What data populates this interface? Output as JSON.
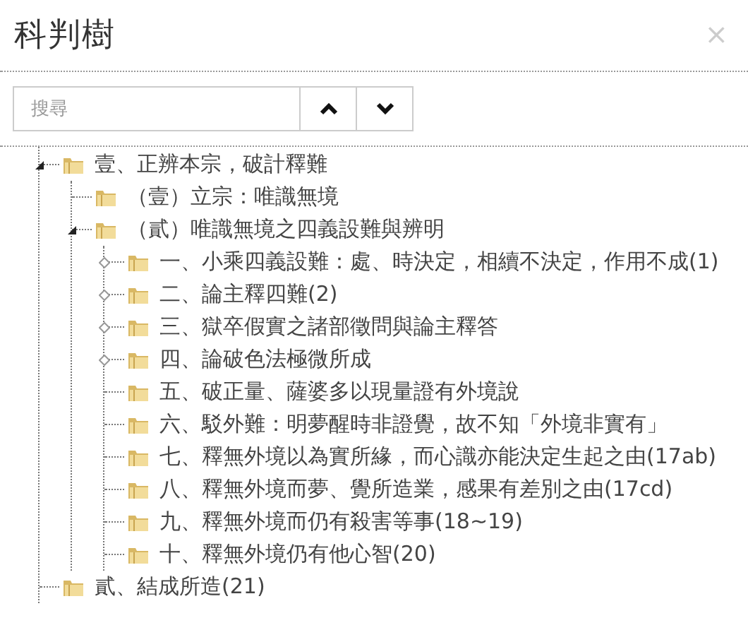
{
  "dialog": {
    "title": "科判樹",
    "close": "×"
  },
  "search": {
    "placeholder": "搜尋"
  },
  "tree": [
    {
      "label": "壹、正辨本宗，破計釋難",
      "expanded": true,
      "children": [
        {
          "label": "（壹）立宗：唯識無境"
        },
        {
          "label": "（貳）唯識無境之四義設難與辨明",
          "expanded": true,
          "children": [
            {
              "label": "一、小乘四義設難：處、時決定，相續不決定，作用不成(1)",
              "expanded": false
            },
            {
              "label": "二、論主釋四難(2)",
              "expanded": false
            },
            {
              "label": "三、獄卒假實之諸部徵問與論主釋答",
              "expanded": false
            },
            {
              "label": "四、論破色法極微所成",
              "expanded": false
            },
            {
              "label": "五、破正量、薩婆多以現量證有外境說"
            },
            {
              "label": "六、駁外難：明夢醒時非證覺，故不知「外境非實有」"
            },
            {
              "label": "七、釋無外境以為實所緣，而心識亦能決定生起之由(17ab)"
            },
            {
              "label": "八、釋無外境而夢、覺所造業，感果有差別之由(17cd)"
            },
            {
              "label": "九、釋無外境而仍有殺害等事(18~19)"
            },
            {
              "label": "十、釋無外境仍有他心智(20)"
            }
          ]
        }
      ]
    },
    {
      "label": "貳、結成所造(21)"
    }
  ]
}
